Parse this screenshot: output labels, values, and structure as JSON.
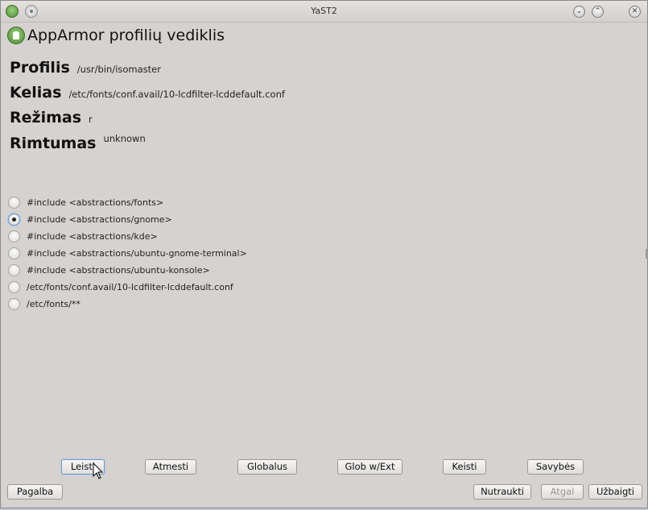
{
  "window": {
    "title": "YaST2"
  },
  "dialog": {
    "heading": "AppArmor profilių vediklis"
  },
  "fields": [
    {
      "label": "Profilis",
      "value": "/usr/bin/isomaster"
    },
    {
      "label": "Kelias",
      "value": "/etc/fonts/conf.avail/10-lcdfilter-lcddefault.conf"
    },
    {
      "label": "Režimas",
      "value": "r"
    },
    {
      "label": "Rimtumas",
      "value": "unknown"
    }
  ],
  "options": [
    {
      "label": "#include <abstractions/fonts>",
      "checked": false
    },
    {
      "label": "#include <abstractions/gnome>",
      "checked": true
    },
    {
      "label": "#include <abstractions/kde>",
      "checked": false
    },
    {
      "label": "#include <abstractions/ubuntu-gnome-terminal>",
      "checked": false
    },
    {
      "label": "#include <abstractions/ubuntu-konsole>",
      "checked": false
    },
    {
      "label": "/etc/fonts/conf.avail/10-lcdfilter-lcddefault.conf",
      "checked": false
    },
    {
      "label": "/etc/fonts/**",
      "checked": false
    }
  ],
  "actions": {
    "allow": "Leisti",
    "deny": "Atmesti",
    "glob": "Globalus",
    "glob_ext": "Glob w/Ext",
    "edit": "Keisti",
    "properties": "Savybės"
  },
  "footer": {
    "help": "Pagalba",
    "abort": "Nutraukti",
    "back": "Atgal",
    "finish": "Užbaigti"
  }
}
